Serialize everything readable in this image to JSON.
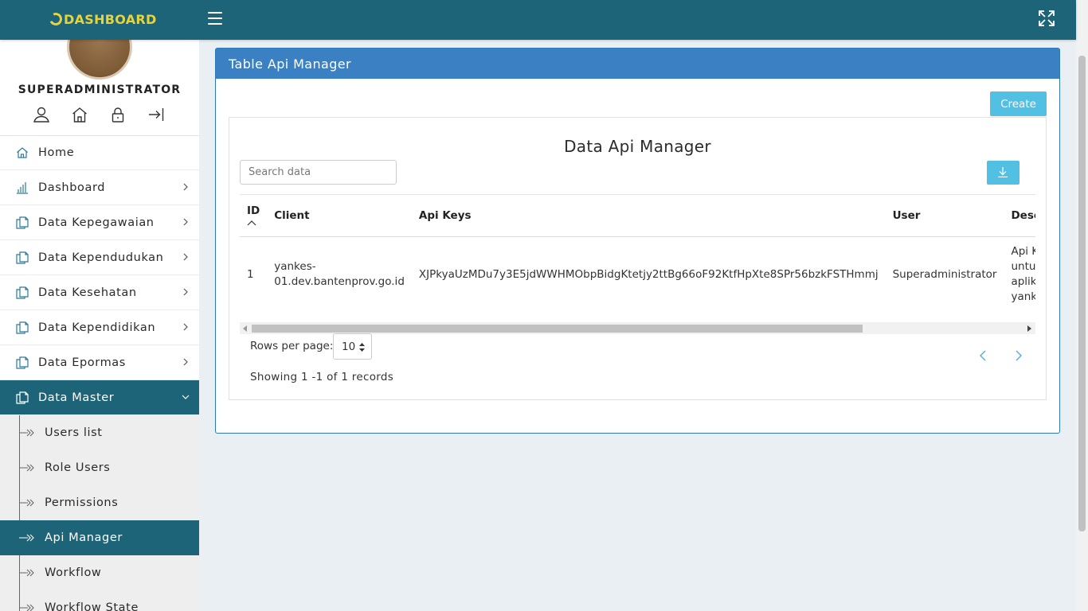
{
  "header": {
    "brand": "DASHBOARD",
    "menu_icon": "hamburger-menu-icon",
    "fullscreen_icon": "fullscreen-icon"
  },
  "sidebar": {
    "username": "SUPERADMINISTRATOR",
    "user_icons": [
      "user-icon",
      "home-icon",
      "lock-icon",
      "logout-icon"
    ],
    "items": [
      {
        "label": "Home",
        "icon": "home-icon",
        "has_children": false
      },
      {
        "label": "Dashboard",
        "icon": "bar-chart-icon",
        "has_children": true
      },
      {
        "label": "Data Kepegawaian",
        "icon": "copy-icon",
        "has_children": true
      },
      {
        "label": "Data Kependudukan",
        "icon": "copy-icon",
        "has_children": true
      },
      {
        "label": "Data Kesehatan",
        "icon": "copy-icon",
        "has_children": true
      },
      {
        "label": "Data Kependidikan",
        "icon": "copy-icon",
        "has_children": true
      },
      {
        "label": "Data Epormas",
        "icon": "copy-icon",
        "has_children": true
      },
      {
        "label": "Data Master",
        "icon": "copy-icon",
        "has_children": true,
        "expanded": true,
        "active": true
      }
    ],
    "sub_items": [
      {
        "label": "Users list"
      },
      {
        "label": "Role Users"
      },
      {
        "label": "Permissions"
      },
      {
        "label": "Api Manager",
        "active": true
      },
      {
        "label": "Workflow"
      },
      {
        "label": "Workflow State"
      }
    ]
  },
  "card": {
    "title": "Table Api Manager",
    "create_label": "Create",
    "inner_title": "Data Api Manager",
    "search_placeholder": "Search data",
    "download_icon": "download-icon"
  },
  "table": {
    "columns": [
      "ID",
      "Client",
      "Api Keys",
      "User",
      "Description"
    ],
    "sort_column": "ID",
    "sort_direction": "asc",
    "rows": [
      {
        "id": "1",
        "client": "yankes-01.dev.bantenprov.go.id",
        "client_line1": "yankes-",
        "client_line2": "01.dev.bantenprov.go.id",
        "api_key": "XJPkyaUzMDu7y3E5jdWWHMObpBidgKtetjy2ttBg66oF92KtfHpXte8SPr56bzkFSTHmmj",
        "user": "Superadministrator",
        "description_lines": [
          "Api Keys",
          "untuk",
          "aplikasi",
          "yankes"
        ]
      }
    ]
  },
  "pagination": {
    "rows_per_page_label": "Rows per page:",
    "rows_per_page": "10",
    "showing": "Showing 1 -1 of 1 records"
  },
  "colors": {
    "primary": "#1e6479",
    "card_header": "#3a80c2",
    "button": "#52c0e3",
    "brand_text": "#e7d43a",
    "page_bg": "#e9eff3"
  }
}
